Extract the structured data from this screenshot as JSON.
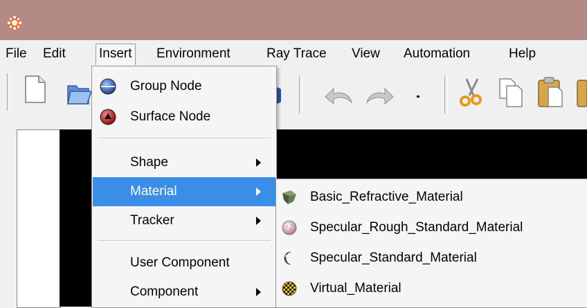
{
  "menubar": {
    "items": [
      "File",
      "Edit",
      "Insert",
      "Environment",
      "Ray Trace",
      "View",
      "Automation",
      "Help"
    ],
    "active": "Insert"
  },
  "toolbar": {
    "icons": [
      "new-document-icon",
      "open-folder-icon",
      "render-sphere-icon",
      "undo-icon",
      "redo-icon",
      "dropdown-arrow-icon",
      "cut-icon",
      "copy-icon",
      "paste-icon"
    ]
  },
  "insert_menu": {
    "items": [
      {
        "label": "Group Node",
        "icon": "group-node-icon",
        "submenu": false
      },
      {
        "label": "Surface Node",
        "icon": "surface-node-icon",
        "submenu": false
      },
      {
        "label": "Shape",
        "submenu": true
      },
      {
        "label": "Material",
        "submenu": true,
        "highlighted": true
      },
      {
        "label": "Tracker",
        "submenu": true
      },
      {
        "label": "User Component",
        "submenu": false
      },
      {
        "label": "Component",
        "submenu": true
      }
    ]
  },
  "material_submenu": {
    "items": [
      {
        "label": "Basic_Refractive_Material",
        "icon": "refractive-material-icon"
      },
      {
        "label": "Specular_Rough_Standard_Material",
        "icon": "rough-material-icon"
      },
      {
        "label": "Specular_Standard_Material",
        "icon": "specular-material-icon"
      },
      {
        "label": "Virtual_Material",
        "icon": "virtual-material-icon"
      }
    ]
  },
  "colors": {
    "titlebar": "#b48a87",
    "highlight": "#3b8ee8",
    "viewport": "#000000"
  }
}
